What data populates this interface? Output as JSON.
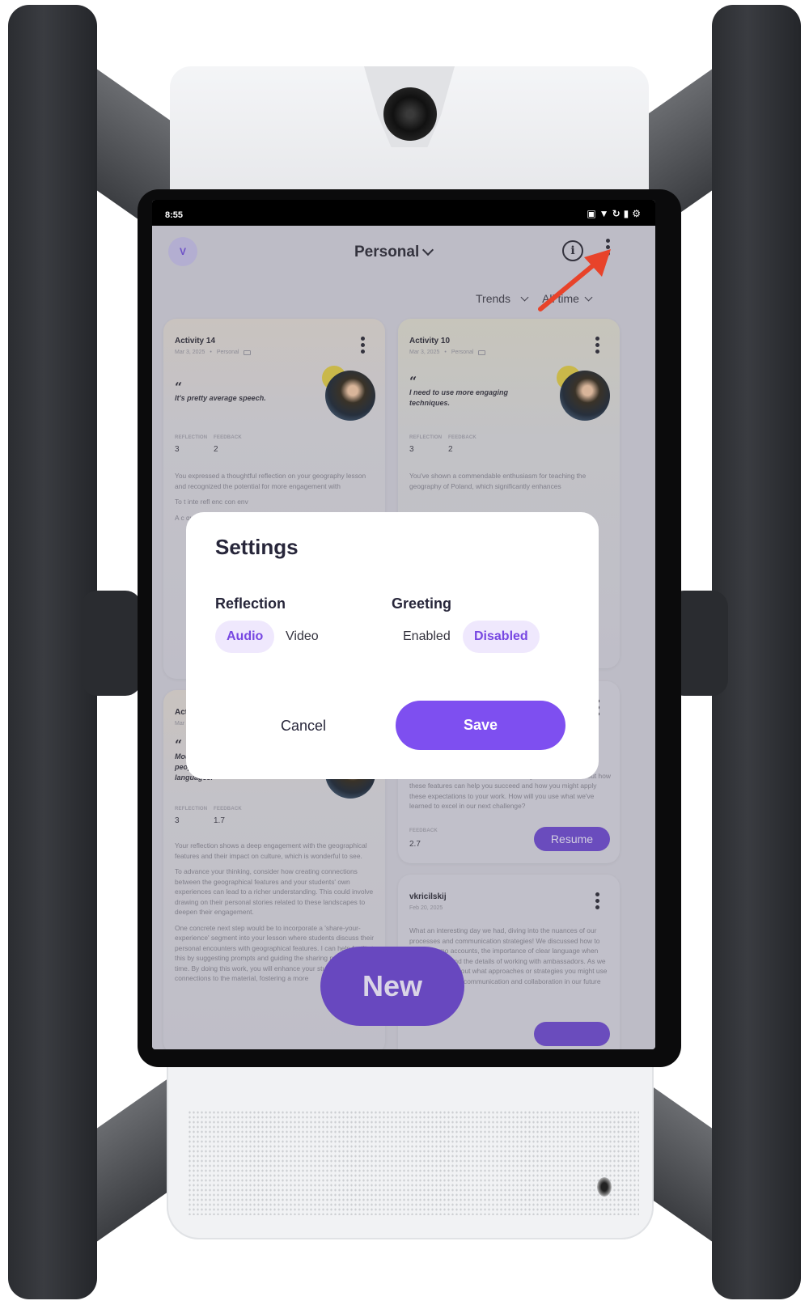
{
  "statusbar": {
    "time": "8:55",
    "icons": [
      "vibrate-icon",
      "wifi-icon",
      "battery-saver-icon",
      "battery-icon",
      "settings-icon"
    ]
  },
  "header": {
    "avatar_initial": "V",
    "workspace": "Personal",
    "info_icon": "i"
  },
  "filters": {
    "view": "Trends",
    "range": "All time"
  },
  "cards": [
    {
      "title": "Activity 14",
      "date": "Mar 3, 2025",
      "category": "Personal",
      "quote": "It's pretty average speech.",
      "reflection_label": "REFLECTION",
      "feedback_label": "FEEDBACK",
      "reflection": "3",
      "feedback": "2",
      "body": [
        "You expressed a thoughtful reflection on your geography lesson and recognized the potential for more engagement with",
        "To t inte refl enc con env",
        "A c que less offe wel This trar exp stu"
      ]
    },
    {
      "title": "Activity 10",
      "date": "Mar 3, 2025",
      "category": "Personal",
      "quote": "I need to use more engaging techniques.",
      "reflection_label": "REFLECTION",
      "feedback_label": "FEEDBACK",
      "reflection": "3",
      "feedback": "2",
      "body": [
        "You've shown a commendable enthusiasm for teaching the geography of Poland, which significantly enhances"
      ]
    },
    {
      "title": "Act",
      "date": "Mar",
      "quote": "Mountains are nature's obstacle for people, separating different cultures and languages.",
      "reflection_label": "REFLECTION",
      "feedback_label": "FEEDBACK",
      "reflection": "3",
      "feedback": "1.7",
      "body": [
        "Your reflection shows a deep engagement with the geographical features and their impact on culture, which is wonderful to see.",
        "To advance your thinking, consider how creating connections between the geographical features and your students' own experiences can lead to a richer understanding. This could involve drawing on their personal stories related to these landscapes to deepen their engagement.",
        "One concrete next step would be to incorporate a 'share-your-experience' segment into your lesson where students discuss their personal encounters with geographical features. I can help facilitate this by suggesting prompts and guiding the sharing process in real-time. By doing this work, you will enhance your students' connections to the material, fostering a more"
      ]
    },
    {
      "body": [
        "reviewed the key components, discussed the objectives, and outlined what we should focus on moving forward. Think about how these features can help you succeed and how you might apply these expectations to your work. How will you use what we've learned to excel in our next challenge?"
      ],
      "feedback_label": "FEEDBACK",
      "feedback": "2.7",
      "resume_label": "Resume"
    },
    {
      "title": "vkricilskij",
      "date": "Feb 20, 2025",
      "body": [
        "What an interesting day we had, diving into the nuances of our processes and communication strategies! We discussed how to handle demo accounts, the importance of clear language when reaching out, and the details of working with ambassadors. As we wrap up, think about what approaches or strategies you might use to ensure smooth communication and collaboration in our future projects."
      ]
    }
  ],
  "fab": {
    "new_label": "New"
  },
  "modal": {
    "title": "Settings",
    "reflection": {
      "label": "Reflection",
      "options": [
        "Audio",
        "Video"
      ],
      "selected": "Audio"
    },
    "greeting": {
      "label": "Greeting",
      "options": [
        "Enabled",
        "Disabled"
      ],
      "selected": "Disabled"
    },
    "cancel_label": "Cancel",
    "save_label": "Save"
  },
  "colors": {
    "accent": "#7e4ff0",
    "accent_selected_bg": "#efe8fd",
    "accent_text": "#7747e2",
    "annotation_arrow": "#e8432a"
  }
}
